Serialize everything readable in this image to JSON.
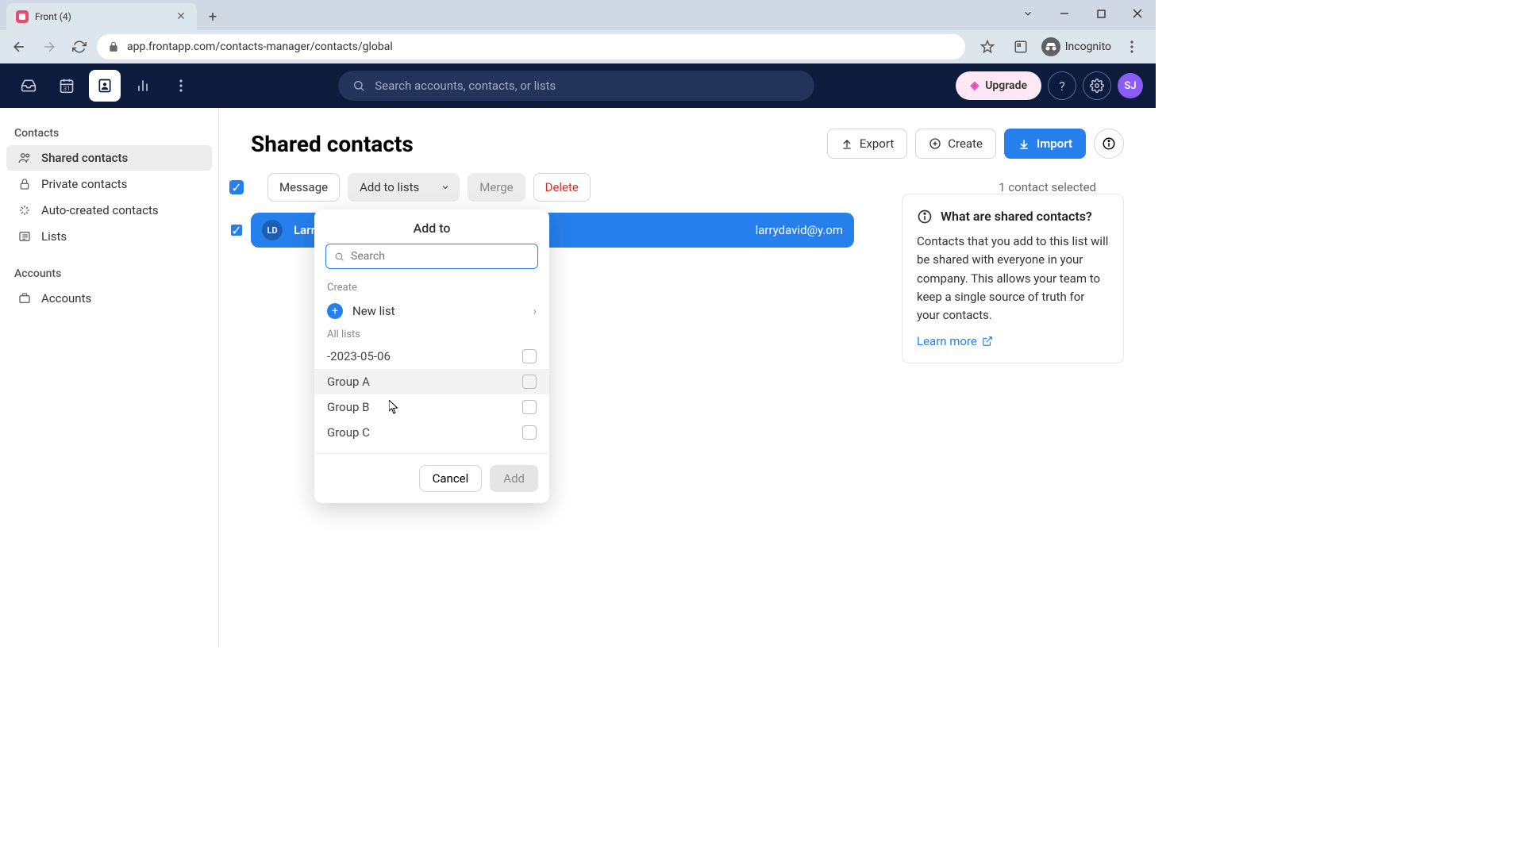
{
  "browser": {
    "tab_title": "Front (4)",
    "url": "app.frontapp.com/contacts-manager/contacts/global",
    "incognito_label": "Incognito"
  },
  "header": {
    "search_placeholder": "Search accounts, contacts, or lists",
    "upgrade_label": "Upgrade",
    "avatar_initials": "SJ"
  },
  "sidebar": {
    "section_contacts": "Contacts",
    "items_contacts": [
      {
        "label": "Shared contacts"
      },
      {
        "label": "Private contacts"
      },
      {
        "label": "Auto-created contacts"
      },
      {
        "label": "Lists"
      }
    ],
    "section_accounts": "Accounts",
    "items_accounts": [
      {
        "label": "Accounts"
      }
    ]
  },
  "page": {
    "title": "Shared contacts",
    "export_label": "Export",
    "create_label": "Create",
    "import_label": "Import"
  },
  "toolbar": {
    "message_label": "Message",
    "add_to_lists_label": "Add to lists",
    "merge_label": "Merge",
    "delete_label": "Delete",
    "selected_text": "1 contact selected"
  },
  "contact": {
    "initials": "LD",
    "name": "Larry Dav",
    "email": "larrydavid@y.om"
  },
  "popover": {
    "title": "Add to",
    "search_placeholder": "Search",
    "create_section": "Create",
    "new_list_label": "New list",
    "all_lists_section": "All lists",
    "lists": [
      {
        "label": "-2023-05-06"
      },
      {
        "label": "Group A"
      },
      {
        "label": "Group B"
      },
      {
        "label": "Group C"
      }
    ],
    "cancel_label": "Cancel",
    "add_label": "Add"
  },
  "info_panel": {
    "title": "What are shared contacts?",
    "body": "Contacts that you add to this list will be shared with everyone in your company. This allows your team to keep a single source of truth for your contacts.",
    "learn_more": "Learn more"
  }
}
